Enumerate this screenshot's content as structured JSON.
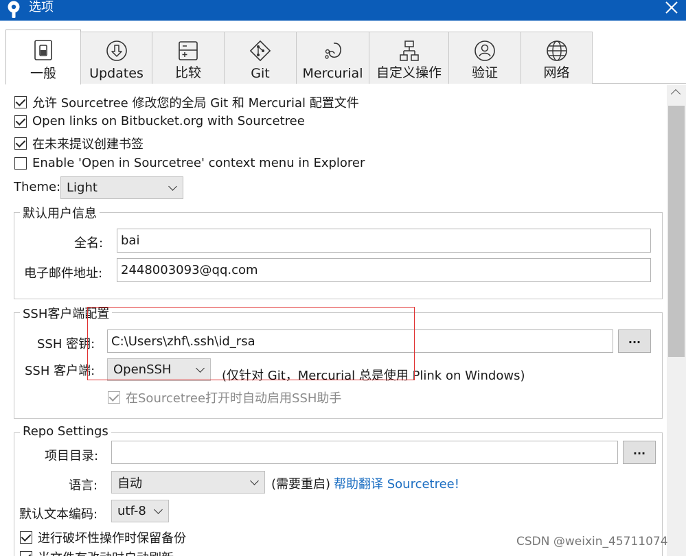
{
  "window": {
    "title": "选项",
    "close_icon": "close-icon",
    "app_icon": "sourcetree-icon"
  },
  "tabs": [
    {
      "label": "一般",
      "icon": "general-icon",
      "active": true
    },
    {
      "label": "Updates",
      "icon": "download-circle-icon"
    },
    {
      "label": "比较",
      "icon": "diff-icon"
    },
    {
      "label": "Git",
      "icon": "git-icon"
    },
    {
      "label": "Mercurial",
      "icon": "mercurial-icon"
    },
    {
      "label": "自定义操作",
      "icon": "custom-actions-icon"
    },
    {
      "label": "验证",
      "icon": "user-circle-icon"
    },
    {
      "label": "网络",
      "icon": "globe-icon"
    }
  ],
  "general": {
    "options": [
      {
        "label": "允许 Sourcetree 修改您的全局 Git 和 Mercurial 配置文件",
        "checked": true
      },
      {
        "label": "Open links on Bitbucket.org with Sourcetree",
        "checked": true
      },
      {
        "label": "在未来提议创建书签",
        "checked": true
      },
      {
        "label": "Enable 'Open in Sourcetree' context menu in Explorer",
        "checked": false
      }
    ],
    "theme": {
      "label": "Theme:",
      "value": "Light"
    }
  },
  "user_info": {
    "legend": "默认用户信息",
    "fullname_label": "全名:",
    "fullname_value": "bai",
    "email_label": "电子邮件地址:",
    "email_value": "2448003093@qq.com"
  },
  "ssh": {
    "legend": "SSH客户端配置",
    "key_label": "SSH 密钥:",
    "key_value": "C:\\Users\\zhf\\.ssh\\id_rsa",
    "browse_label": "...",
    "client_label": "SSH 客户端:",
    "client_value": "OpenSSH",
    "client_note": "(仅针对 Git，Mercurial 总是使用 Plink on Windows)",
    "agent_label": "在Sourcetree打开时自动启用SSH助手",
    "agent_checked": true,
    "agent_disabled": true
  },
  "repo": {
    "legend": "Repo Settings",
    "project_dir_label": "项目目录:",
    "project_dir_value": "",
    "browse_label": "...",
    "language_label": "语言:",
    "language_value": "自动",
    "restart_note": "(需要重启)",
    "translate_link": "帮助翻译 Sourcetree!",
    "encoding_label": "默认文本编码:",
    "encoding_value": "utf-8",
    "backup_label": "进行破坏性操作时保留备份",
    "backup_checked": true,
    "refresh_label": "当文件有改动时自动刷新",
    "refresh_checked": true
  },
  "watermark": "CSDN @weixin_45711074",
  "colors": {
    "titlebar": "#0b5cb8",
    "link": "#1b6ec2",
    "annotation": "#e03030"
  }
}
